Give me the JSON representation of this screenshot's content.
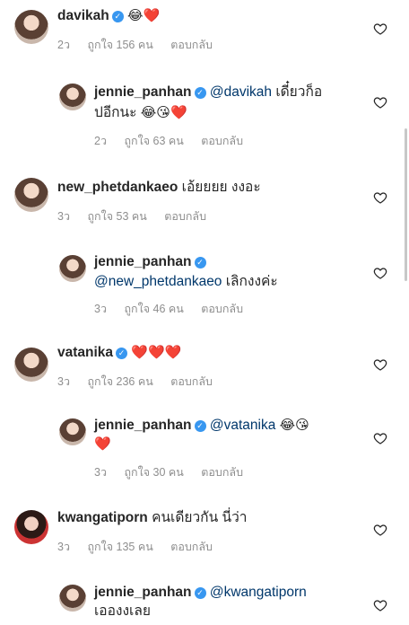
{
  "comments": [
    {
      "user": "davikah",
      "text": "",
      "emoji": "😂❤️",
      "time": "2ว",
      "likes": "ถูกใจ 156 คน",
      "reply": "ตอบกลับ"
    },
    {
      "user": "jennie_panhan",
      "mention": "@davikah",
      "text": " เดี๋ยวก็อ",
      "text2": "ปอีกนะ",
      "emoji": "😂😘❤️",
      "time": "2ว",
      "likes": "ถูกใจ 63 คน",
      "reply": "ตอบกลับ"
    },
    {
      "user": "new_phetdankaeo",
      "text": " เอ้ยยยย งงอะ",
      "time": "3ว",
      "likes": "ถูกใจ 53 คน",
      "reply": "ตอบกลับ"
    },
    {
      "user": "jennie_panhan",
      "mention": "@new_phetdankaeo",
      "text": " เลิกงงค่ะ",
      "time": "3ว",
      "likes": "ถูกใจ 46 คน",
      "reply": "ตอบกลับ"
    },
    {
      "user": "vatanika",
      "emoji": "❤️❤️❤️",
      "time": "3ว",
      "likes": "ถูกใจ 236 คน",
      "reply": "ตอบกลับ"
    },
    {
      "user": "jennie_panhan",
      "mention": "@vatanika",
      "emoji": "😂😘",
      "emoji2": "❤️",
      "time": "3ว",
      "likes": "ถูกใจ 30 คน",
      "reply": "ตอบกลับ"
    },
    {
      "user": "kwangatiporn",
      "text": " คนเดียวกัน นี่ว่า",
      "time": "3ว",
      "likes": "ถูกใจ 135 คน",
      "reply": "ตอบกลับ"
    },
    {
      "user": "jennie_panhan",
      "mention": "@kwangatiporn",
      "text2": "เอองงเลย"
    }
  ],
  "icons": {
    "heart": "heart-outline-icon",
    "verified": "verified-badge-icon"
  },
  "colors": {
    "mention": "#00376b",
    "meta": "#8e8e8e",
    "verified": "#3897f0"
  }
}
